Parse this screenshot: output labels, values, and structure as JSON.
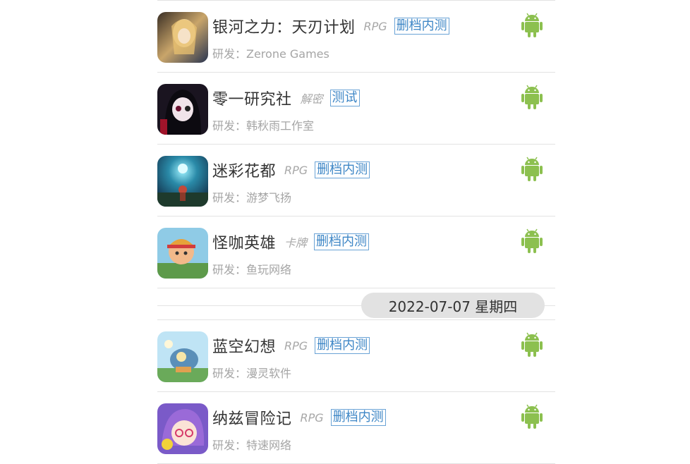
{
  "games_group_1": [
    {
      "title": "银河之力：天刃计划",
      "genre": "RPG",
      "status": "删档内测",
      "developer": "研发：Zerone Games",
      "platform_icon": "android-icon"
    },
    {
      "title": "零一研究社",
      "genre": "解密",
      "status": "测试",
      "developer": "研发：韩秋雨工作室",
      "platform_icon": "android-icon"
    },
    {
      "title": "迷彩花都",
      "genre": "RPG",
      "status": "删档内测",
      "developer": "研发：游梦飞扬",
      "platform_icon": "android-icon"
    },
    {
      "title": "怪咖英雄",
      "genre": "卡牌",
      "status": "删档内测",
      "developer": "研发：鱼玩网络",
      "platform_icon": "android-icon"
    }
  ],
  "date_divider": "2022-07-07 星期四",
  "games_group_2": [
    {
      "title": "蓝空幻想",
      "genre": "RPG",
      "status": "删档内测",
      "developer": "研发：漫灵软件",
      "platform_icon": "android-icon"
    },
    {
      "title": "纳兹冒险记",
      "genre": "RPG",
      "status": "删档内测",
      "developer": "研发：特速网络",
      "platform_icon": "android-icon"
    }
  ],
  "colors": {
    "status_blue": "#3d86c6",
    "android_green": "#8cc04f",
    "muted_text": "#a5a5a5",
    "date_pill_bg": "#e2e2e2"
  }
}
